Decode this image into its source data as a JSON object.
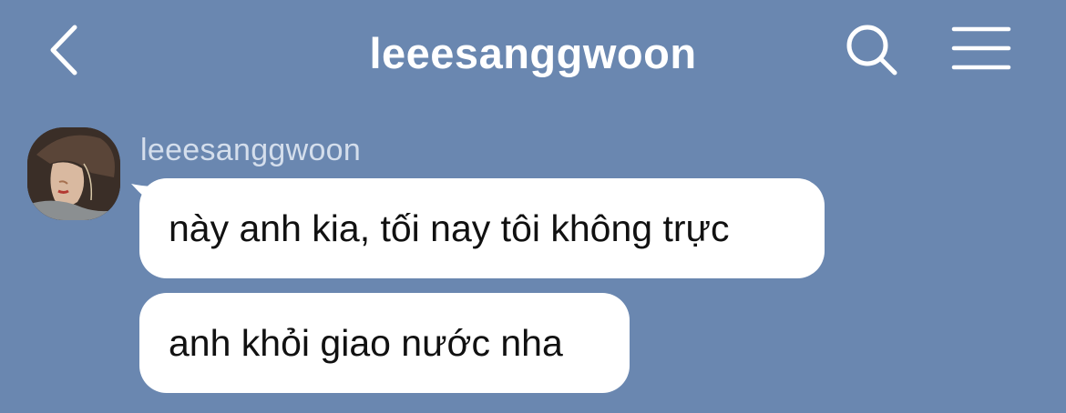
{
  "header": {
    "title": "leeesanggwoon",
    "back_icon": "chevron-left-icon",
    "search_icon": "search-icon",
    "menu_icon": "hamburger-menu-icon"
  },
  "chat": {
    "sender_name": "leeesanggwoon",
    "avatar_icon": "avatar",
    "messages": [
      {
        "text": "này anh kia, tối nay tôi không trực"
      },
      {
        "text": "anh khỏi giao nước nha"
      }
    ]
  },
  "colors": {
    "background": "#6a87b0",
    "bubble": "#ffffff",
    "title_text": "#ffffff",
    "sender_text": "#d4deec"
  }
}
